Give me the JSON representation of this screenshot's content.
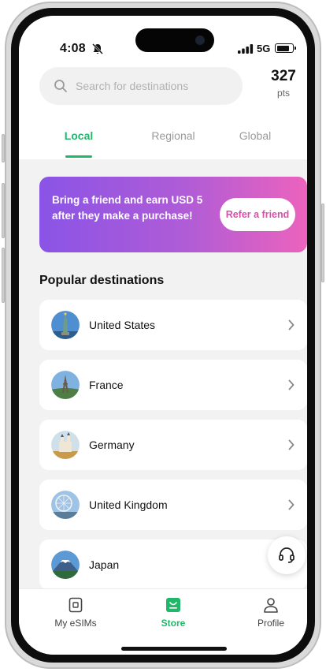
{
  "status_bar": {
    "time": "4:08",
    "network": "5G"
  },
  "search": {
    "placeholder": "Search for destinations",
    "value": ""
  },
  "points": {
    "value": "327",
    "unit": "pts"
  },
  "tabs": [
    {
      "label": "Local",
      "active": true
    },
    {
      "label": "Regional",
      "active": false
    },
    {
      "label": "Global",
      "active": false
    }
  ],
  "banner": {
    "text": "Bring a friend and earn USD 5 after they make a purchase!",
    "button_label": "Refer a friend"
  },
  "section_title": "Popular destinations",
  "destinations": [
    {
      "name": "United States",
      "flag_icon": "statue-of-liberty-icon"
    },
    {
      "name": "France",
      "flag_icon": "eiffel-tower-icon"
    },
    {
      "name": "Germany",
      "flag_icon": "castle-icon"
    },
    {
      "name": "United Kingdom",
      "flag_icon": "london-eye-icon"
    },
    {
      "name": "Japan",
      "flag_icon": "mount-fuji-icon"
    }
  ],
  "bottom_nav": [
    {
      "label": "My eSIMs",
      "icon": "sim-card-icon",
      "active": false
    },
    {
      "label": "Store",
      "icon": "shopping-bag-icon",
      "active": true
    },
    {
      "label": "Profile",
      "icon": "person-icon",
      "active": false
    }
  ],
  "colors": {
    "accent": "#1fb86a",
    "banner_start": "#8a54e6",
    "banner_end": "#ec63bd",
    "background": "#f2f2f2"
  }
}
